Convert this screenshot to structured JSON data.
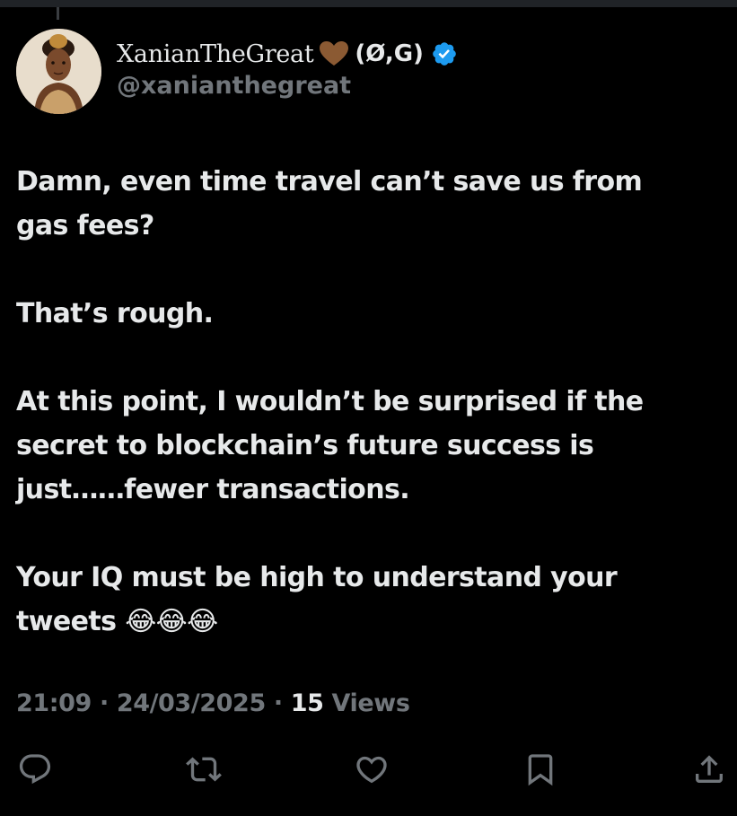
{
  "author": {
    "display_name": "XanianTheGreat",
    "name_suffix": "(Ø,G)",
    "handle": "@xanianthegreat",
    "heart_color": "#8b5a33",
    "verified_color": "#1d9bf0"
  },
  "tweet": {
    "paragraphs": [
      "Damn, even time travel can’t save us from\ngas fees?",
      "That’s rough.",
      "At this point, I wouldn’t be surprised if the\nsecret to blockchain’s future success is\njust……fewer transactions.",
      "Your IQ must be high to understand your\ntweets 😂😂😂"
    ]
  },
  "meta": {
    "time": "21:09",
    "separator": "·",
    "date": "24/03/2025",
    "views_count": "15",
    "views_label": "Views"
  },
  "actions": {
    "icons": [
      "reply-icon",
      "retweet-icon",
      "like-icon",
      "bookmark-icon",
      "share-icon"
    ],
    "icon_color": "#71767b"
  }
}
